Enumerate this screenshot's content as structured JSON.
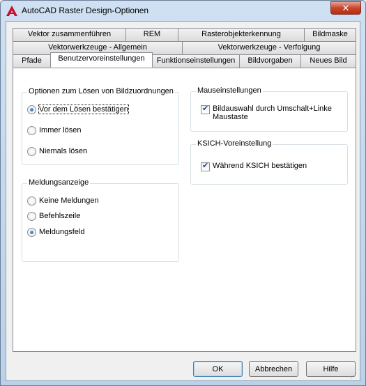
{
  "window": {
    "title": "AutoCAD Raster Design-Optionen",
    "close_glyph": "✕"
  },
  "tabs": {
    "row1": [
      "Vektor zusammenführen",
      "REM",
      "Rasterobjekterkennung",
      "Bildmaske"
    ],
    "row2": [
      "Vektorwerkzeuge - Allgemein",
      "Vektorwerkzeuge - Verfolgung"
    ],
    "row3": [
      "Pfade",
      "Benutzervoreinstellungen",
      "Funktionseinstellungen",
      "Bildvorgaben",
      "Neues Bild"
    ],
    "active": "Benutzervoreinstellungen"
  },
  "groups": {
    "resolve": {
      "title": "Optionen zum Lösen von Bildzuordnungen",
      "options": [
        "Vor dem Lösen bestätigen",
        "Immer lösen",
        "Niemals lösen"
      ],
      "selected": "Vor dem Lösen bestätigen"
    },
    "messages": {
      "title": "Meldungsanzeige",
      "options": [
        "Keine Meldungen",
        "Befehlszeile",
        "Meldungsfeld"
      ],
      "selected": "Meldungsfeld"
    },
    "mouse": {
      "title": "Mauseinstellungen",
      "checkbox": "Bildauswahl durch Umschalt+Linke Maustaste",
      "checked": true
    },
    "ksich": {
      "title": "KSICH-Voreinstellung",
      "checkbox": "Während KSICH bestätigen",
      "checked": true
    }
  },
  "buttons": {
    "ok": "OK",
    "cancel": "Abbrechen",
    "help": "Hilfe"
  },
  "icons": {
    "app": "autocad-a-icon",
    "close": "close-icon"
  }
}
